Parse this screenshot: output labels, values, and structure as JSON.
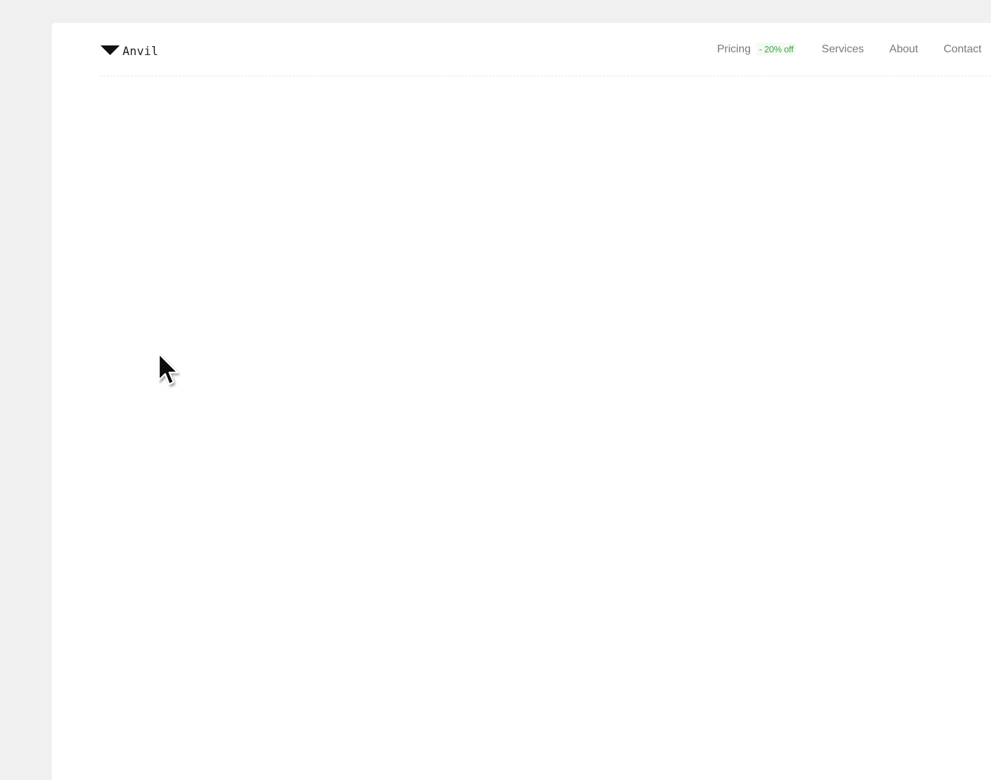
{
  "brand": {
    "name": "Anvil",
    "icon": "down-triangle-logo-icon"
  },
  "nav": {
    "items": [
      {
        "label": "Pricing",
        "badge": "- 20% off"
      },
      {
        "label": "Services"
      },
      {
        "label": "About"
      },
      {
        "label": "Contact"
      }
    ]
  },
  "colors": {
    "page_background": "#f0f0f0",
    "card_background": "#ffffff",
    "nav_text": "#7a7a7a",
    "badge_text": "#3fa34d",
    "brand_text": "#222222"
  },
  "cursor": {
    "icon": "mouse-pointer-icon"
  }
}
